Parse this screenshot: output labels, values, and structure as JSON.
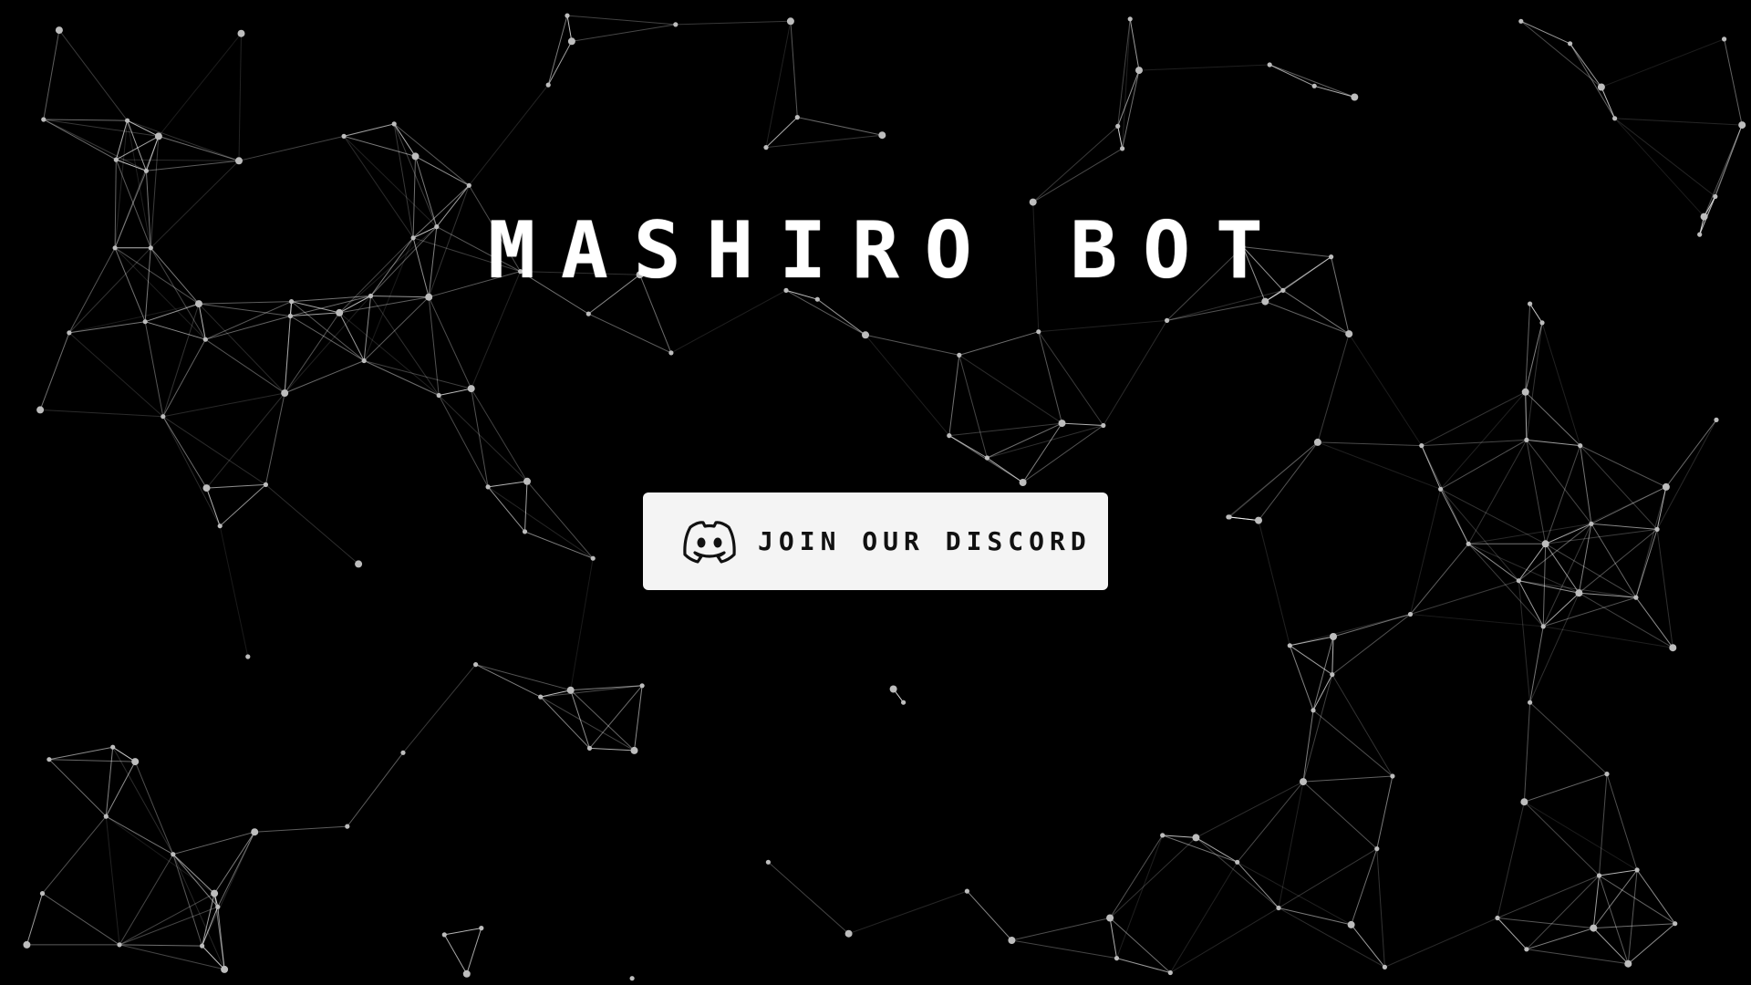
{
  "page": {
    "title": "MASHIRO BOT",
    "background_color": "#000000",
    "network_color": "#ffffff"
  },
  "cta": {
    "label": "JOIN OUR DISCORD",
    "icon": "discord-icon",
    "background_color": "#f4f4f4",
    "text_color": "#111111"
  }
}
